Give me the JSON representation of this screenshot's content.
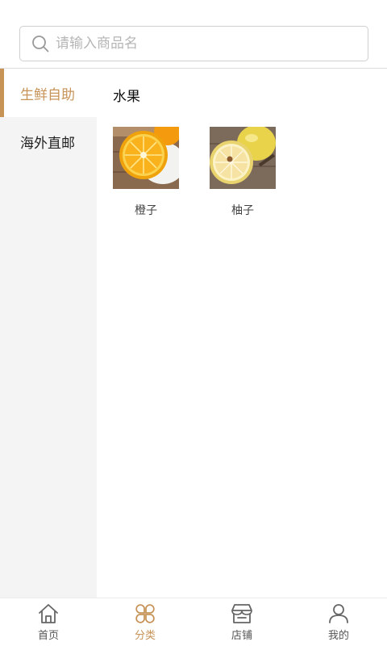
{
  "search": {
    "placeholder": "请输入商品名",
    "value": ""
  },
  "sidebar": {
    "items": [
      {
        "label": "生鲜自助",
        "active": true
      },
      {
        "label": "海外直邮",
        "active": false
      }
    ]
  },
  "main": {
    "category_title": "水果",
    "products": [
      {
        "name": "橙子",
        "image": "orange-photo"
      },
      {
        "name": "柚子",
        "image": "pomelo-photo"
      }
    ]
  },
  "tabbar": {
    "tabs": [
      {
        "label": "首页",
        "icon": "home-icon",
        "active": false
      },
      {
        "label": "分类",
        "icon": "category-icon",
        "active": true
      },
      {
        "label": "店铺",
        "icon": "store-icon",
        "active": false
      },
      {
        "label": "我的",
        "icon": "user-icon",
        "active": false
      }
    ]
  },
  "colors": {
    "accent": "#c79357",
    "sidebar_bg": "#f4f4f4",
    "text": "#222222",
    "muted": "#b6b6b6"
  }
}
